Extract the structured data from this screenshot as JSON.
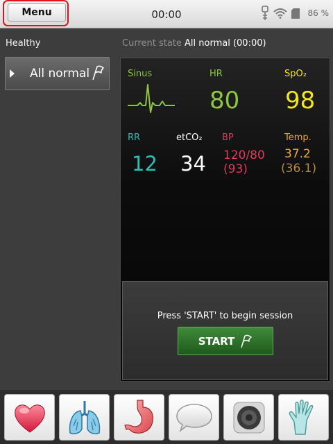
{
  "topbar": {
    "menu_label": "Menu",
    "clock": "00:00",
    "battery": "86 %"
  },
  "sidebar": {
    "heading": "Healthy",
    "items": [
      {
        "label": "All normal"
      }
    ]
  },
  "current_state": {
    "prefix": "Current state",
    "value": "All normal (00:00)"
  },
  "monitor": {
    "sinus_label": "Sinus",
    "hr": {
      "label": "HR",
      "value": "80",
      "color": "#8dc63f"
    },
    "spo2": {
      "label": "SpO₂",
      "value": "98",
      "color": "#f4e51a"
    },
    "rr": {
      "label": "RR",
      "value": "12",
      "color": "#2fbfb0"
    },
    "etco2": {
      "label": "etCO₂",
      "value": "34",
      "color": "#ffffff"
    },
    "bp": {
      "label": "BP",
      "value": "120/80",
      "mean": "(93)",
      "color": "#e03a5c"
    },
    "temp": {
      "label": "Temp.",
      "value": "37.2",
      "secondary": "(36.1)",
      "color": "#f0a830",
      "secondary_color": "#b58a3a"
    }
  },
  "start": {
    "message": "Press 'START' to begin session",
    "button_label": "START"
  },
  "toolbar": {
    "buttons": [
      "heart-icon",
      "lungs-icon",
      "stomach-icon",
      "speech-bubble-icon",
      "speaker-icon",
      "glove-icon"
    ]
  }
}
